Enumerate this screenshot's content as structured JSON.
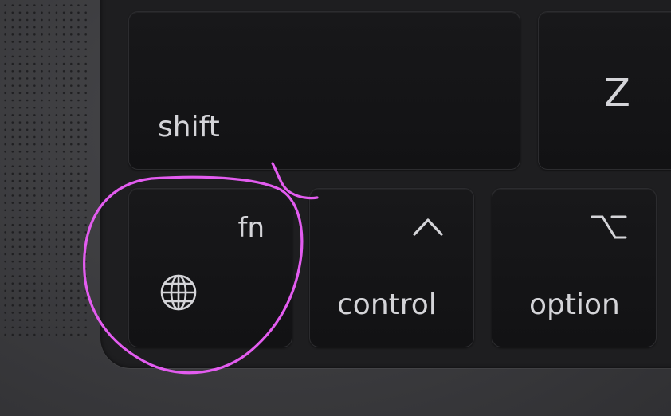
{
  "keys": {
    "shift": {
      "label": "shift"
    },
    "z": {
      "label": "Z"
    },
    "fn": {
      "label": "fn",
      "icon": "globe-icon"
    },
    "control": {
      "label": "control",
      "icon": "caret-up-icon"
    },
    "option": {
      "label": "option",
      "icon": "option-symbol-icon"
    }
  },
  "colors": {
    "body": "#3a3a3d",
    "key": "#141416",
    "key_text": "#d4d4d8",
    "annotation": "#e35cf0"
  }
}
